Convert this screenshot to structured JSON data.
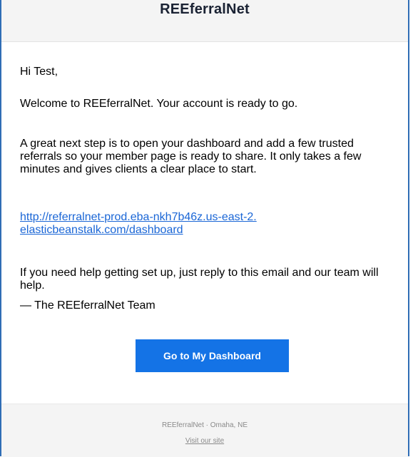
{
  "header": {
    "brand": "REEferralNet"
  },
  "body": {
    "greeting": "Hi Test,",
    "welcome": "Welcome to REEferralNet. Your account is ready to go.",
    "next_step": "A great next step is to open your dashboard and add a few trusted referrals so your member page is ready to share. It only takes a few minutes and gives clients a clear place to start.",
    "dashboard_link": "http://referralnet-prod.eba-nkh7b46z.us-east-2.elasticbeanstalk.com/dashboard",
    "help": "If you need help getting set up, just reply to this email and our team will help.",
    "signature": "— The REEferralNet Team",
    "cta_label": "Go to My Dashboard"
  },
  "footer": {
    "company_line": "REEferralNet · Omaha, NE",
    "visit_link": "Visit our site"
  },
  "colors": {
    "accent": "#1473e6",
    "border": "#2f6db5",
    "link": "#1a66d6"
  }
}
